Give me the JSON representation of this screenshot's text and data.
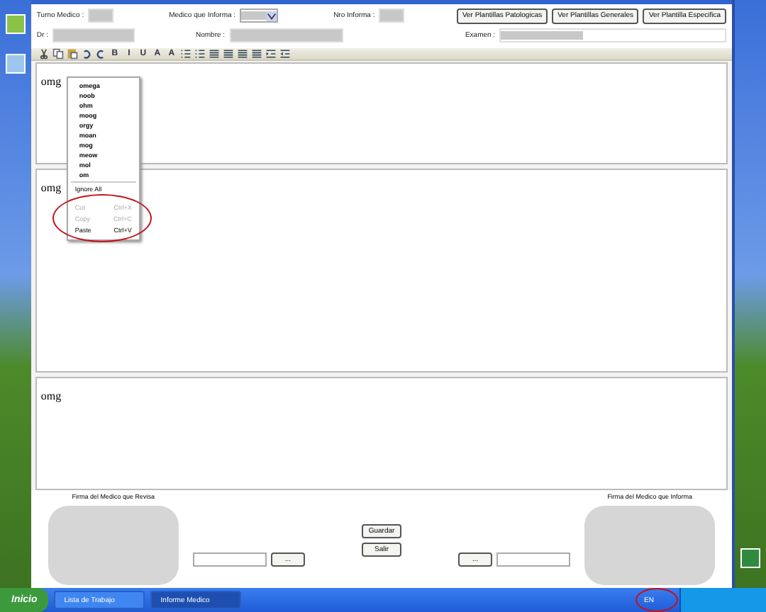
{
  "header": {
    "turno_label": "Turno Medico :",
    "medico_label": "Medico que Informa :",
    "nro_label": "Nro Informa :",
    "buttons": [
      "Ver Plantillas Patologicas",
      "Ver Plantillas Generales",
      "Ver Plantilla Especifica"
    ],
    "dr_label": "Dr :",
    "nombre_label": "Nombre :",
    "examen_label": "Examen :"
  },
  "toolbar": [
    {
      "kind": "cut"
    },
    {
      "kind": "copy"
    },
    {
      "kind": "paste"
    },
    {
      "kind": "undo"
    },
    {
      "kind": "redo"
    },
    {
      "kind": "text",
      "glyph": "B"
    },
    {
      "kind": "text",
      "glyph": "I"
    },
    {
      "kind": "text",
      "glyph": "U"
    },
    {
      "kind": "text",
      "glyph": "A"
    },
    {
      "kind": "text",
      "glyph": "A"
    },
    {
      "kind": "bullets"
    },
    {
      "kind": "numbers"
    },
    {
      "kind": "align"
    },
    {
      "kind": "align"
    },
    {
      "kind": "align"
    },
    {
      "kind": "align"
    },
    {
      "kind": "indent"
    },
    {
      "kind": "outdent"
    }
  ],
  "editors": [
    {
      "text": "omg"
    },
    {
      "text": "omg"
    },
    {
      "text": "omg"
    }
  ],
  "context_menu": {
    "suggestions": [
      "omega",
      "noob",
      "ohm",
      "moog",
      "orgy",
      "moan",
      "mog",
      "meow",
      "mol",
      "om"
    ],
    "items": [
      {
        "label": "Ignore All",
        "disabled": false
      },
      {
        "label": "Cut",
        "shortcut": "Ctrl+X",
        "disabled": true
      },
      {
        "label": "Copy",
        "shortcut": "Ctrl+C",
        "disabled": true
      },
      {
        "label": "Paste",
        "shortcut": "Ctrl+V",
        "disabled": false
      }
    ]
  },
  "footer": {
    "left_label": "Firma del Medico que Revisa",
    "right_label": "Firma del Medico que Informa",
    "save": "Guardar",
    "exit": "Salir",
    "browse_left": "...",
    "browse_right": "..."
  },
  "taskbar": {
    "start": "Inicio",
    "tasks": [
      {
        "label": "Lista de Trabajo",
        "selected": false
      },
      {
        "label": "Informe Medico",
        "selected": true
      }
    ],
    "language": "EN"
  }
}
